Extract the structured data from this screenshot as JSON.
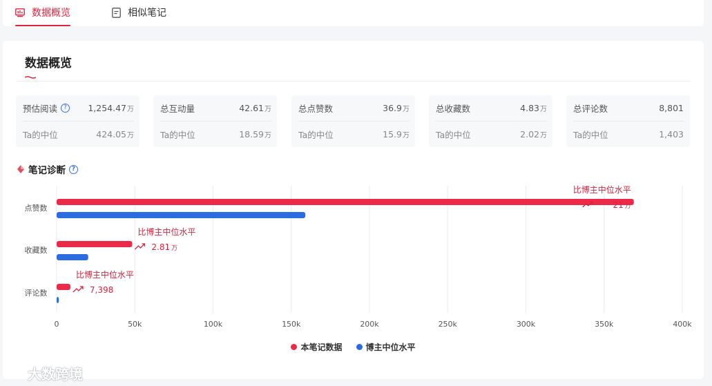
{
  "tabs": [
    {
      "label": "数据概览",
      "active": true,
      "icon": "monitor-chart-icon"
    },
    {
      "label": "相似笔记",
      "active": false,
      "icon": "document-icon"
    }
  ],
  "title": "数据概览",
  "stats": [
    {
      "label": "预估阅读",
      "help": true,
      "value": "1,254.47",
      "unit": "万",
      "sub_label": "Ta的中位",
      "sub_value": "424.05",
      "sub_unit": "万"
    },
    {
      "label": "总互动量",
      "help": false,
      "value": "42.61",
      "unit": "万",
      "sub_label": "Ta的中位",
      "sub_value": "18.59",
      "sub_unit": "万"
    },
    {
      "label": "总点赞数",
      "help": false,
      "value": "36.9",
      "unit": "万",
      "sub_label": "Ta的中位",
      "sub_value": "15.9",
      "sub_unit": "万"
    },
    {
      "label": "总收藏数",
      "help": false,
      "value": "4.83",
      "unit": "万",
      "sub_label": "Ta的中位",
      "sub_value": "2.02",
      "sub_unit": "万"
    },
    {
      "label": "总评论数",
      "help": false,
      "value": "8,801",
      "unit": "",
      "sub_label": "Ta的中位",
      "sub_value": "1,403",
      "sub_unit": ""
    }
  ],
  "section_title": "笔记诊断",
  "help_glyph": "?",
  "watermark": "大数跨境",
  "colors": {
    "accent": "#e0233e",
    "blue": "#2b6de0"
  },
  "chart_data": {
    "type": "bar",
    "orientation": "horizontal",
    "categories": [
      "点赞数",
      "收藏数",
      "评论数"
    ],
    "series": [
      {
        "name": "本笔记数据",
        "color": "#ec2a48",
        "values": [
          369000,
          48300,
          8801
        ]
      },
      {
        "name": "博主中位水平",
        "color": "#2b6de0",
        "values": [
          159000,
          20200,
          1403
        ]
      }
    ],
    "annotations": [
      {
        "text": "比博主中位水平",
        "value": "21",
        "unit": "万"
      },
      {
        "text": "比博主中位水平",
        "value": "2.81",
        "unit": "万"
      },
      {
        "text": "比博主中位水平",
        "value": "7,398",
        "unit": ""
      }
    ],
    "ticks": [
      0,
      50000,
      100000,
      150000,
      200000,
      250000,
      300000,
      350000,
      400000
    ],
    "tick_labels": [
      "0",
      "50k",
      "100k",
      "150k",
      "200k",
      "250k",
      "300k",
      "350k",
      "400k"
    ],
    "xlim": [
      0,
      400000
    ],
    "grid": true,
    "legend": "bottom-center"
  }
}
